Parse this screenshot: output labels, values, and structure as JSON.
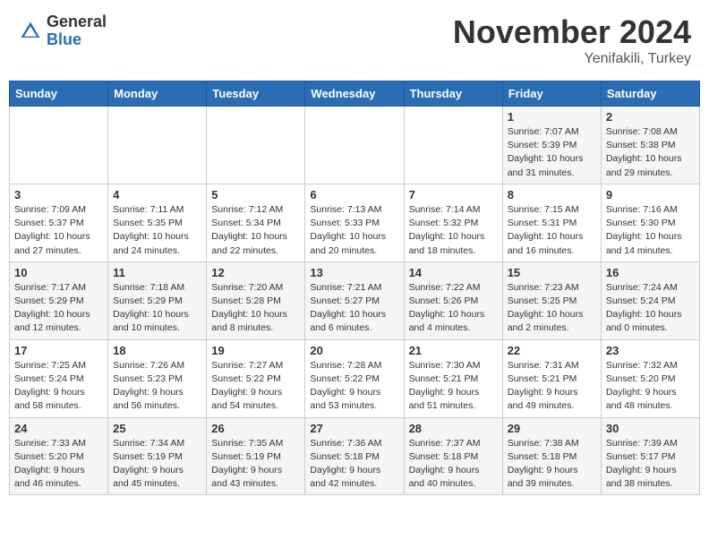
{
  "header": {
    "logo_general": "General",
    "logo_blue": "Blue",
    "month_title": "November 2024",
    "location": "Yenifakili, Turkey"
  },
  "calendar": {
    "days_of_week": [
      "Sunday",
      "Monday",
      "Tuesday",
      "Wednesday",
      "Thursday",
      "Friday",
      "Saturday"
    ],
    "weeks": [
      [
        {
          "day": "",
          "info": ""
        },
        {
          "day": "",
          "info": ""
        },
        {
          "day": "",
          "info": ""
        },
        {
          "day": "",
          "info": ""
        },
        {
          "day": "",
          "info": ""
        },
        {
          "day": "1",
          "info": "Sunrise: 7:07 AM\nSunset: 5:39 PM\nDaylight: 10 hours\nand 31 minutes."
        },
        {
          "day": "2",
          "info": "Sunrise: 7:08 AM\nSunset: 5:38 PM\nDaylight: 10 hours\nand 29 minutes."
        }
      ],
      [
        {
          "day": "3",
          "info": "Sunrise: 7:09 AM\nSunset: 5:37 PM\nDaylight: 10 hours\nand 27 minutes."
        },
        {
          "day": "4",
          "info": "Sunrise: 7:11 AM\nSunset: 5:35 PM\nDaylight: 10 hours\nand 24 minutes."
        },
        {
          "day": "5",
          "info": "Sunrise: 7:12 AM\nSunset: 5:34 PM\nDaylight: 10 hours\nand 22 minutes."
        },
        {
          "day": "6",
          "info": "Sunrise: 7:13 AM\nSunset: 5:33 PM\nDaylight: 10 hours\nand 20 minutes."
        },
        {
          "day": "7",
          "info": "Sunrise: 7:14 AM\nSunset: 5:32 PM\nDaylight: 10 hours\nand 18 minutes."
        },
        {
          "day": "8",
          "info": "Sunrise: 7:15 AM\nSunset: 5:31 PM\nDaylight: 10 hours\nand 16 minutes."
        },
        {
          "day": "9",
          "info": "Sunrise: 7:16 AM\nSunset: 5:30 PM\nDaylight: 10 hours\nand 14 minutes."
        }
      ],
      [
        {
          "day": "10",
          "info": "Sunrise: 7:17 AM\nSunset: 5:29 PM\nDaylight: 10 hours\nand 12 minutes."
        },
        {
          "day": "11",
          "info": "Sunrise: 7:18 AM\nSunset: 5:29 PM\nDaylight: 10 hours\nand 10 minutes."
        },
        {
          "day": "12",
          "info": "Sunrise: 7:20 AM\nSunset: 5:28 PM\nDaylight: 10 hours\nand 8 minutes."
        },
        {
          "day": "13",
          "info": "Sunrise: 7:21 AM\nSunset: 5:27 PM\nDaylight: 10 hours\nand 6 minutes."
        },
        {
          "day": "14",
          "info": "Sunrise: 7:22 AM\nSunset: 5:26 PM\nDaylight: 10 hours\nand 4 minutes."
        },
        {
          "day": "15",
          "info": "Sunrise: 7:23 AM\nSunset: 5:25 PM\nDaylight: 10 hours\nand 2 minutes."
        },
        {
          "day": "16",
          "info": "Sunrise: 7:24 AM\nSunset: 5:24 PM\nDaylight: 10 hours\nand 0 minutes."
        }
      ],
      [
        {
          "day": "17",
          "info": "Sunrise: 7:25 AM\nSunset: 5:24 PM\nDaylight: 9 hours\nand 58 minutes."
        },
        {
          "day": "18",
          "info": "Sunrise: 7:26 AM\nSunset: 5:23 PM\nDaylight: 9 hours\nand 56 minutes."
        },
        {
          "day": "19",
          "info": "Sunrise: 7:27 AM\nSunset: 5:22 PM\nDaylight: 9 hours\nand 54 minutes."
        },
        {
          "day": "20",
          "info": "Sunrise: 7:28 AM\nSunset: 5:22 PM\nDaylight: 9 hours\nand 53 minutes."
        },
        {
          "day": "21",
          "info": "Sunrise: 7:30 AM\nSunset: 5:21 PM\nDaylight: 9 hours\nand 51 minutes."
        },
        {
          "day": "22",
          "info": "Sunrise: 7:31 AM\nSunset: 5:21 PM\nDaylight: 9 hours\nand 49 minutes."
        },
        {
          "day": "23",
          "info": "Sunrise: 7:32 AM\nSunset: 5:20 PM\nDaylight: 9 hours\nand 48 minutes."
        }
      ],
      [
        {
          "day": "24",
          "info": "Sunrise: 7:33 AM\nSunset: 5:20 PM\nDaylight: 9 hours\nand 46 minutes."
        },
        {
          "day": "25",
          "info": "Sunrise: 7:34 AM\nSunset: 5:19 PM\nDaylight: 9 hours\nand 45 minutes."
        },
        {
          "day": "26",
          "info": "Sunrise: 7:35 AM\nSunset: 5:19 PM\nDaylight: 9 hours\nand 43 minutes."
        },
        {
          "day": "27",
          "info": "Sunrise: 7:36 AM\nSunset: 5:18 PM\nDaylight: 9 hours\nand 42 minutes."
        },
        {
          "day": "28",
          "info": "Sunrise: 7:37 AM\nSunset: 5:18 PM\nDaylight: 9 hours\nand 40 minutes."
        },
        {
          "day": "29",
          "info": "Sunrise: 7:38 AM\nSunset: 5:18 PM\nDaylight: 9 hours\nand 39 minutes."
        },
        {
          "day": "30",
          "info": "Sunrise: 7:39 AM\nSunset: 5:17 PM\nDaylight: 9 hours\nand 38 minutes."
        }
      ]
    ]
  }
}
